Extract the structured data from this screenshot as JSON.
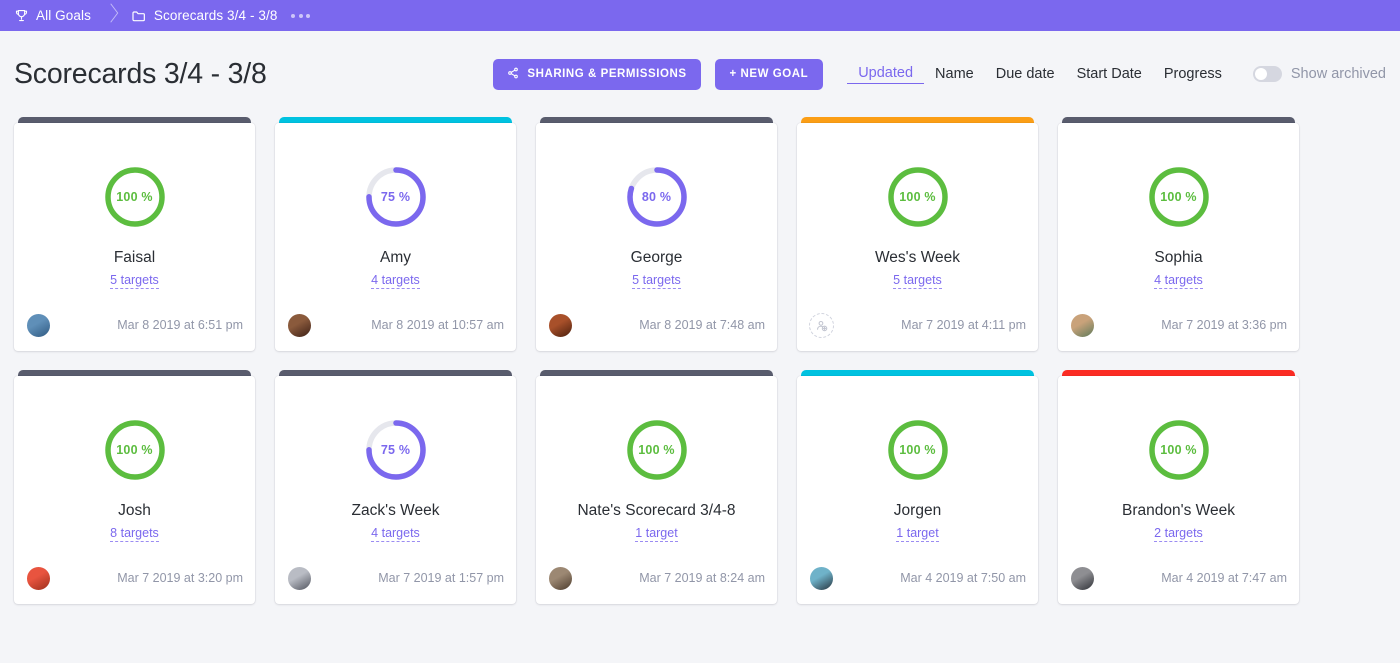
{
  "breadcrumb": {
    "root_label": "All Goals",
    "root_icon": "trophy-icon",
    "folder_label": "Scorecards 3/4 - 3/8",
    "folder_icon": "folder-icon",
    "overflow_icon": "more-dots-icon"
  },
  "header": {
    "title": "Scorecards 3/4 - 3/8",
    "share_button": "SHARING & PERMISSIONS",
    "share_icon": "share-icon",
    "new_goal_button": "+ NEW GOAL",
    "sort_options": [
      {
        "label": "Updated",
        "active": true
      },
      {
        "label": "Name",
        "active": false
      },
      {
        "label": "Due date",
        "active": false
      },
      {
        "label": "Start Date",
        "active": false
      },
      {
        "label": "Progress",
        "active": false
      }
    ],
    "show_archived_label": "Show archived",
    "show_archived_on": false
  },
  "colors": {
    "brand_purple": "#7b68ee",
    "ring_green": "#5cbd3f",
    "ring_purple": "#7b68ee",
    "ring_track": "#e6e7ed",
    "bar_gray": "#595c6d",
    "bar_cyan": "#00c2e0",
    "bar_orange": "#fb9e16",
    "bar_red": "#fb2c23",
    "page_bg": "#f4f5f8"
  },
  "cards": [
    {
      "name": "Faisal",
      "percent": 100,
      "percent_label": "100 %",
      "targets_label": "5 targets",
      "date": "Mar 8 2019 at 6:51 pm",
      "bar_color": "#595c6d",
      "ring_color": "#5cbd3f",
      "avatar": {
        "type": "photo",
        "color_a": "#5f8fb8",
        "color_b": "#2f5a82",
        "extra": true
      }
    },
    {
      "name": "Amy",
      "percent": 75,
      "percent_label": "75 %",
      "targets_label": "4 targets",
      "date": "Mar 8 2019 at 10:57 am",
      "bar_color": "#00c2e0",
      "ring_color": "#7b68ee",
      "avatar": {
        "type": "photo",
        "color_a": "#8a5a3c",
        "color_b": "#3d2016",
        "extra": false
      }
    },
    {
      "name": "George",
      "percent": 80,
      "percent_label": "80 %",
      "targets_label": "5 targets",
      "date": "Mar 8 2019 at 7:48 am",
      "bar_color": "#595c6d",
      "ring_color": "#7b68ee",
      "avatar": {
        "type": "photo",
        "color_a": "#a8502a",
        "color_b": "#4a1f0d",
        "extra": false
      }
    },
    {
      "name": "Wes's Week",
      "percent": 100,
      "percent_label": "100 %",
      "targets_label": "5 targets",
      "date": "Mar 7 2019 at 4:11 pm",
      "bar_color": "#fb9e16",
      "ring_color": "#5cbd3f",
      "avatar": {
        "type": "placeholder",
        "color_a": "",
        "color_b": "",
        "extra": false
      }
    },
    {
      "name": "Sophia",
      "percent": 100,
      "percent_label": "100 %",
      "targets_label": "4 targets",
      "date": "Mar 7 2019 at 3:36 pm",
      "bar_color": "#595c6d",
      "ring_color": "#5cbd3f",
      "avatar": {
        "type": "photo",
        "color_a": "#c9a27a",
        "color_b": "#5d7a5a",
        "extra": false
      }
    },
    {
      "name": "Josh",
      "percent": 100,
      "percent_label": "100 %",
      "targets_label": "8 targets",
      "date": "Mar 7 2019 at 3:20 pm",
      "bar_color": "#595c6d",
      "ring_color": "#5cbd3f",
      "avatar": {
        "type": "photo",
        "color_a": "#e8543f",
        "color_b": "#9c2f1c",
        "extra": false
      }
    },
    {
      "name": "Zack's Week",
      "percent": 75,
      "percent_label": "75 %",
      "targets_label": "4 targets",
      "date": "Mar 7 2019 at 1:57 pm",
      "bar_color": "#595c6d",
      "ring_color": "#7b68ee",
      "avatar": {
        "type": "photo",
        "color_a": "#b9bcc4",
        "color_b": "#51545e",
        "extra": false
      }
    },
    {
      "name": "Nate's Scorecard 3/4-8",
      "percent": 100,
      "percent_label": "100 %",
      "targets_label": "1 target",
      "date": "Mar 7 2019 at 8:24 am",
      "bar_color": "#595c6d",
      "ring_color": "#5cbd3f",
      "avatar": {
        "type": "photo",
        "color_a": "#9c8873",
        "color_b": "#4c3b2c",
        "extra": false
      }
    },
    {
      "name": "Jorgen",
      "percent": 100,
      "percent_label": "100 %",
      "targets_label": "1 target",
      "date": "Mar 4 2019 at 7:50 am",
      "bar_color": "#00c2e0",
      "ring_color": "#5cbd3f",
      "avatar": {
        "type": "photo",
        "color_a": "#6fb2c9",
        "color_b": "#27333d",
        "extra": false
      }
    },
    {
      "name": "Brandon's Week",
      "percent": 100,
      "percent_label": "100 %",
      "targets_label": "2 targets",
      "date": "Mar 4 2019 at 7:47 am",
      "bar_color": "#fb2c23",
      "ring_color": "#5cbd3f",
      "avatar": {
        "type": "photo",
        "color_a": "#8e8e92",
        "color_b": "#2e3036",
        "extra": false
      }
    }
  ]
}
